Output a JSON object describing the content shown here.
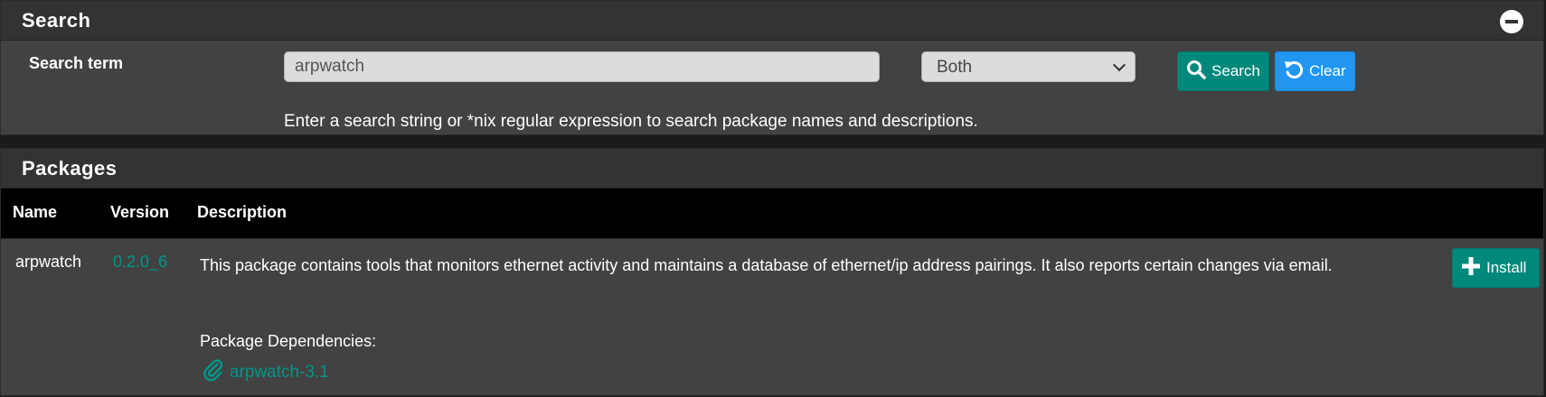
{
  "search": {
    "title": "Search",
    "term_label": "Search term",
    "input_value": "arpwatch",
    "select_value": "Both",
    "search_button": "Search",
    "clear_button": "Clear",
    "help_text": "Enter a search string or *nix regular expression to search package names and descriptions."
  },
  "packages": {
    "title": "Packages",
    "columns": [
      "Name",
      "Version",
      "Description"
    ],
    "rows": [
      {
        "name": "arpwatch",
        "version": "0.2.0_6",
        "description": "This package contains tools that monitors ethernet activity and maintains a database of ethernet/ip address pairings. It also reports certain changes via email.",
        "deps_label": "Package Dependencies:",
        "dependency": "arpwatch-3.1",
        "install_button": "Install"
      }
    ]
  },
  "colors": {
    "teal": "#00897b",
    "blue": "#2196f3",
    "link": "#009688",
    "panel": "#424242",
    "heading": "#333333"
  },
  "icons": {
    "collapse": "minus-circle-icon",
    "search": "search-icon",
    "clear": "undo-icon",
    "install": "plus-icon",
    "dependency": "paperclip-icon"
  }
}
